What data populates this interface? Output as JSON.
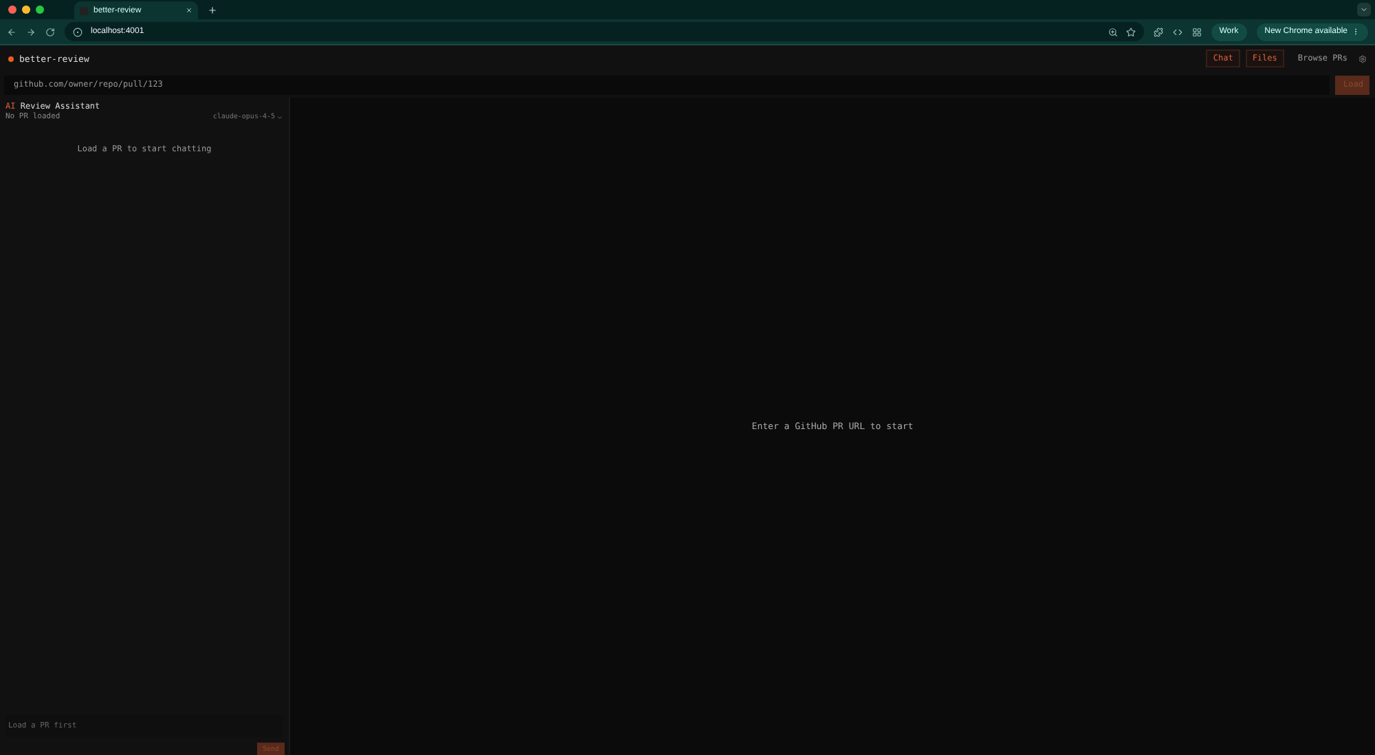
{
  "browser": {
    "tab_title": "better-review",
    "address": "localhost:4001",
    "profile": "Work",
    "update": "New Chrome available"
  },
  "app": {
    "name": "better-review",
    "toggles": [
      {
        "label": "Chat",
        "selected": true
      },
      {
        "label": "Files",
        "selected": true
      }
    ],
    "browse": "Browse PRs"
  },
  "url_bar": {
    "placeholder": "github.com/owner/repo/pull/123",
    "button": "Load",
    "disabled": true
  },
  "chat": {
    "title_prefix": "AI",
    "title": "Review Assistant",
    "status": "No PR loaded",
    "model": "claude-opus-4-5",
    "empty": "Load a PR to start chatting",
    "input_placeholder": "Load a PR first",
    "send": "Send",
    "disabled": true
  },
  "main": {
    "empty": "Enter a GitHub PR URL to start"
  }
}
